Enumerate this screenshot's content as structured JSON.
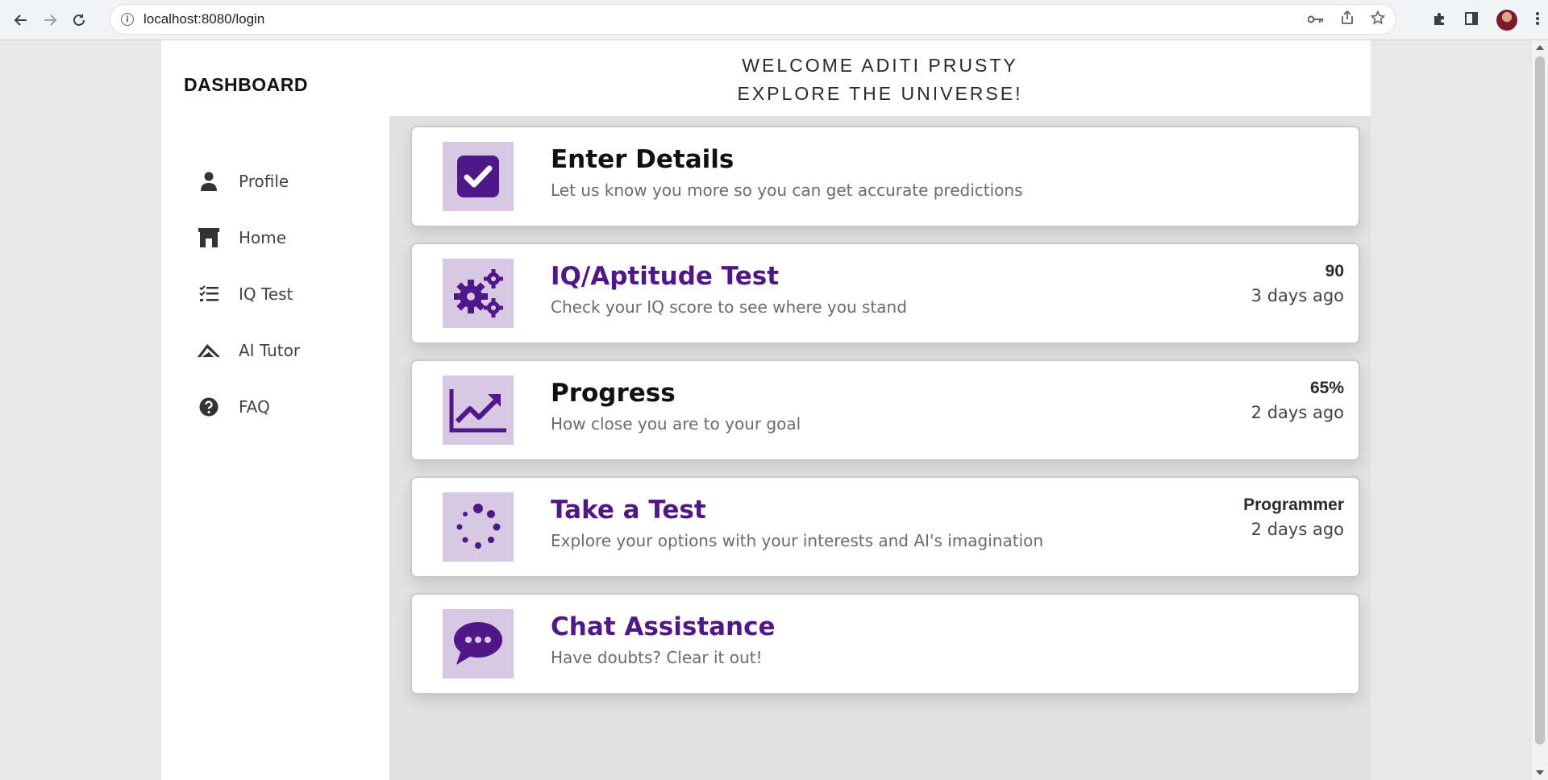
{
  "browser": {
    "url": "localhost:8080/login"
  },
  "colors": {
    "accent": "#4f1787",
    "icon_bg": "#d8c8e3"
  },
  "sidebar": {
    "brand": "DASHBOARD",
    "items": [
      {
        "label": "Profile",
        "icon": "person-icon"
      },
      {
        "label": "Home",
        "icon": "home-icon"
      },
      {
        "label": "IQ Test",
        "icon": "checklist-icon"
      },
      {
        "label": "AI Tutor",
        "icon": "tutor-icon"
      },
      {
        "label": "FAQ",
        "icon": "question-icon"
      }
    ]
  },
  "header": {
    "line1": "WELCOME ADITI PRUSTY",
    "line2": "EXPLORE THE UNIVERSE!"
  },
  "cards": [
    {
      "title": "Enter Details",
      "desc": "Let us know you more so you can get accurate predictions",
      "icon": "checkbox-icon",
      "value": "",
      "time": ""
    },
    {
      "title": "IQ/Aptitude Test",
      "desc": "Check your IQ score to see where you stand",
      "icon": "gears-icon",
      "value": "90",
      "time": "3 days ago"
    },
    {
      "title": "Progress",
      "desc": "How close you are to your goal",
      "icon": "chart-line-icon",
      "value": "65%",
      "time": "2 days ago"
    },
    {
      "title": "Take a Test",
      "desc": "Explore your options with your interests and AI's imagination",
      "icon": "spinner-icon",
      "value": "Programmer",
      "time": "2 days ago"
    },
    {
      "title": "Chat Assistance",
      "desc": "Have doubts? Clear it out!",
      "icon": "chat-icon",
      "value": "",
      "time": ""
    }
  ]
}
